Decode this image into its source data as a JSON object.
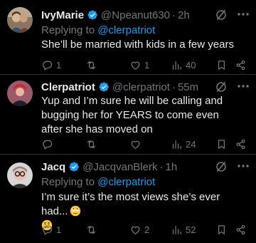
{
  "tweets": [
    {
      "name": "IvyMarie",
      "handle": "@Npeanut630",
      "dot": "·",
      "time": "2h",
      "replying_prefix": "Replying to ",
      "replying_to": "@clerpatriot",
      "text": "She’ll be married with kids in a few years",
      "reply_count": "1",
      "repost_count": "",
      "like_count": "1",
      "view_count": "40"
    },
    {
      "name": "Clerpatriot",
      "handle": "@clerpatriot",
      "dot": "·",
      "time": "55m",
      "text": "Yup and I’m sure he will be calling and bugging her for YEARS to come even after she has moved on",
      "reply_count": "",
      "repost_count": "",
      "like_count": "",
      "view_count": "24"
    },
    {
      "name": "Jacq",
      "handle": "@JacqvanBlerk",
      "dot": "·",
      "time": "1h",
      "replying_prefix": "Replying to ",
      "replying_to": "@clerpatriot",
      "text": "I’m sure it’s the most views she’s ever had...",
      "reply_count": "1",
      "repost_count": "",
      "like_count": "2",
      "view_count": "52"
    }
  ],
  "colors": {
    "background": "#000000",
    "text": "#e7e9ea",
    "muted": "#71767b",
    "accent": "#1d9bf0",
    "divider": "#2f3336"
  },
  "icons": [
    "verified-badge-icon",
    "grok-icon",
    "more-icon",
    "reply-icon",
    "repost-icon",
    "like-icon",
    "views-icon",
    "bookmark-icon",
    "share-icon",
    "rolling-eyes-emoji",
    "frowning-emoji"
  ]
}
